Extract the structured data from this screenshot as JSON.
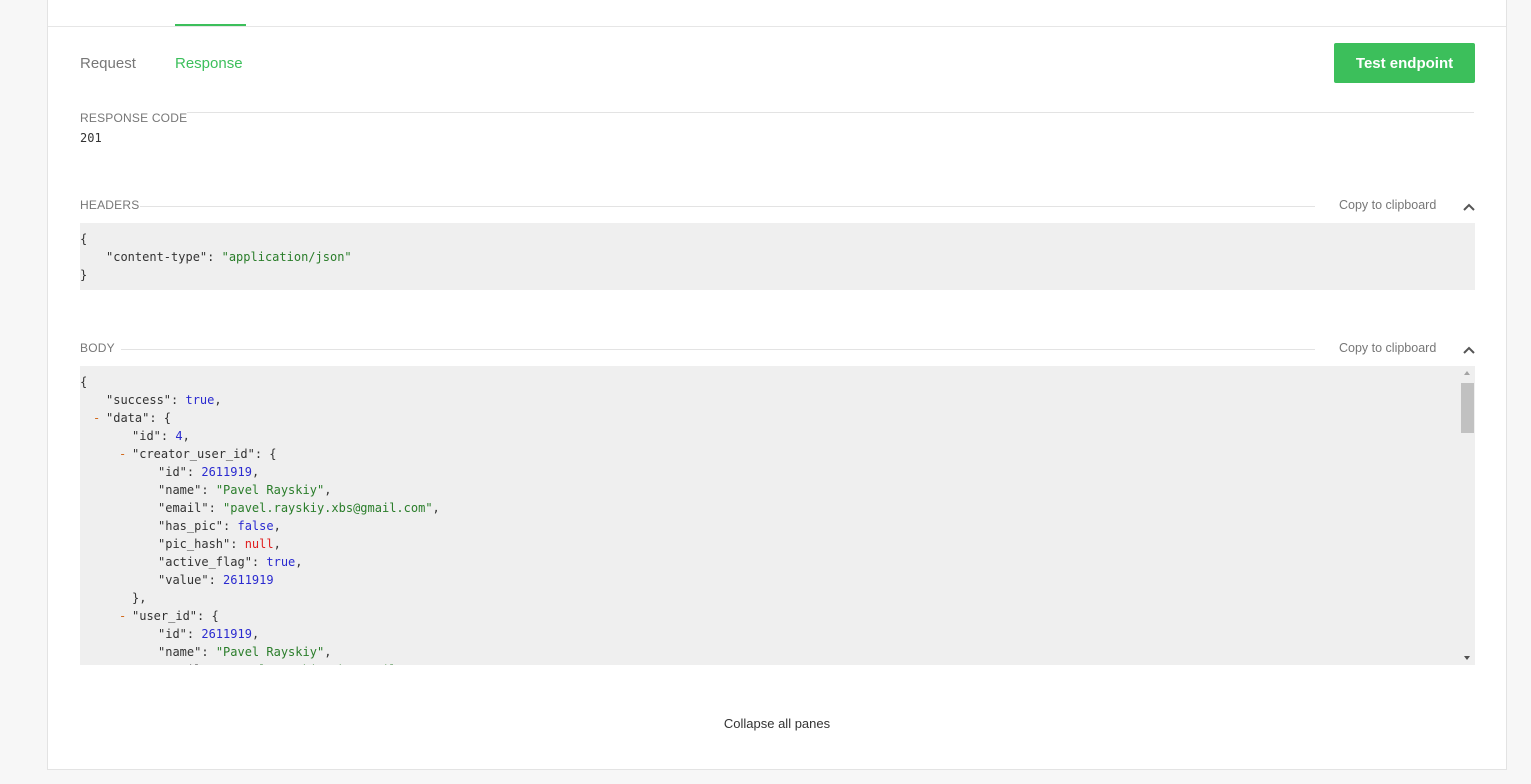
{
  "tabs": {
    "request": "Request",
    "response": "Response"
  },
  "test_button": "Test endpoint",
  "response_code": {
    "label": "RESPONSE CODE",
    "value": "201"
  },
  "headers": {
    "label": "HEADERS",
    "copy": "Copy to clipboard",
    "lines": [
      {
        "indent": 0,
        "parts": [
          {
            "t": "{",
            "c": "k"
          }
        ]
      },
      {
        "indent": 1,
        "parts": [
          {
            "t": "\"content-type\"",
            "c": "k"
          },
          {
            "t": ": ",
            "c": "k"
          },
          {
            "t": "\"application/json\"",
            "c": "s"
          }
        ]
      },
      {
        "indent": 0,
        "parts": [
          {
            "t": "}",
            "c": "k"
          }
        ]
      }
    ]
  },
  "body": {
    "label": "BODY",
    "copy": "Copy to clipboard",
    "lines": [
      {
        "indent": 0,
        "parts": [
          {
            "t": "{",
            "c": "k"
          }
        ]
      },
      {
        "indent": 1,
        "parts": [
          {
            "t": "\"success\"",
            "c": "k"
          },
          {
            "t": ": ",
            "c": "k"
          },
          {
            "t": "true",
            "c": "b"
          },
          {
            "t": ",",
            "c": "k"
          }
        ]
      },
      {
        "indent": 1,
        "toggle": true,
        "parts": [
          {
            "t": "\"data\"",
            "c": "k"
          },
          {
            "t": ": {",
            "c": "k"
          }
        ]
      },
      {
        "indent": 2,
        "parts": [
          {
            "t": "\"id\"",
            "c": "k"
          },
          {
            "t": ": ",
            "c": "k"
          },
          {
            "t": "4",
            "c": "n"
          },
          {
            "t": ",",
            "c": "k"
          }
        ]
      },
      {
        "indent": 2,
        "toggle": true,
        "parts": [
          {
            "t": "\"creator_user_id\"",
            "c": "k"
          },
          {
            "t": ": {",
            "c": "k"
          }
        ]
      },
      {
        "indent": 3,
        "parts": [
          {
            "t": "\"id\"",
            "c": "k"
          },
          {
            "t": ": ",
            "c": "k"
          },
          {
            "t": "2611919",
            "c": "n"
          },
          {
            "t": ",",
            "c": "k"
          }
        ]
      },
      {
        "indent": 3,
        "parts": [
          {
            "t": "\"name\"",
            "c": "k"
          },
          {
            "t": ": ",
            "c": "k"
          },
          {
            "t": "\"Pavel Rayskiy\"",
            "c": "s"
          },
          {
            "t": ",",
            "c": "k"
          }
        ]
      },
      {
        "indent": 3,
        "parts": [
          {
            "t": "\"email\"",
            "c": "k"
          },
          {
            "t": ": ",
            "c": "k"
          },
          {
            "t": "\"pavel.rayskiy.xbs@gmail.com\"",
            "c": "s"
          },
          {
            "t": ",",
            "c": "k"
          }
        ]
      },
      {
        "indent": 3,
        "parts": [
          {
            "t": "\"has_pic\"",
            "c": "k"
          },
          {
            "t": ": ",
            "c": "k"
          },
          {
            "t": "false",
            "c": "b"
          },
          {
            "t": ",",
            "c": "k"
          }
        ]
      },
      {
        "indent": 3,
        "parts": [
          {
            "t": "\"pic_hash\"",
            "c": "k"
          },
          {
            "t": ": ",
            "c": "k"
          },
          {
            "t": "null",
            "c": "nul"
          },
          {
            "t": ",",
            "c": "k"
          }
        ]
      },
      {
        "indent": 3,
        "parts": [
          {
            "t": "\"active_flag\"",
            "c": "k"
          },
          {
            "t": ": ",
            "c": "k"
          },
          {
            "t": "true",
            "c": "b"
          },
          {
            "t": ",",
            "c": "k"
          }
        ]
      },
      {
        "indent": 3,
        "parts": [
          {
            "t": "\"value\"",
            "c": "k"
          },
          {
            "t": ": ",
            "c": "k"
          },
          {
            "t": "2611919",
            "c": "n"
          }
        ]
      },
      {
        "indent": 2,
        "parts": [
          {
            "t": "},",
            "c": "k"
          }
        ]
      },
      {
        "indent": 2,
        "toggle": true,
        "parts": [
          {
            "t": "\"user_id\"",
            "c": "k"
          },
          {
            "t": ": {",
            "c": "k"
          }
        ]
      },
      {
        "indent": 3,
        "parts": [
          {
            "t": "\"id\"",
            "c": "k"
          },
          {
            "t": ": ",
            "c": "k"
          },
          {
            "t": "2611919",
            "c": "n"
          },
          {
            "t": ",",
            "c": "k"
          }
        ]
      },
      {
        "indent": 3,
        "parts": [
          {
            "t": "\"name\"",
            "c": "k"
          },
          {
            "t": ": ",
            "c": "k"
          },
          {
            "t": "\"Pavel Rayskiy\"",
            "c": "s"
          },
          {
            "t": ",",
            "c": "k"
          }
        ]
      },
      {
        "indent": 3,
        "parts": [
          {
            "t": "\"email\"",
            "c": "k"
          },
          {
            "t": ": ",
            "c": "k"
          },
          {
            "t": "\"pavel.rayskiy.xbs@gmail.com\"",
            "c": "s"
          },
          {
            "t": ",",
            "c": "k"
          }
        ]
      }
    ]
  },
  "toggle_symbol": "-",
  "collapse_all": "Collapse all panes",
  "colors": {
    "accent": "#3cbf5b",
    "string": "#2a7d2a",
    "literal": "#2a2ad0",
    "null": "#e02020",
    "toggle": "#d26a1e"
  }
}
